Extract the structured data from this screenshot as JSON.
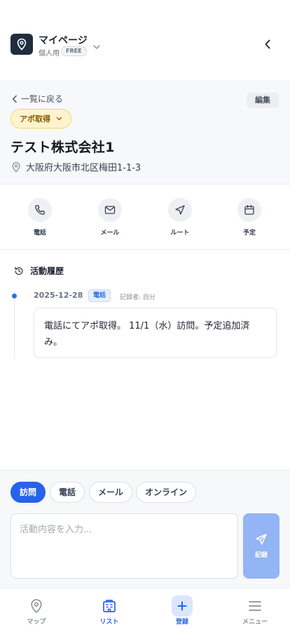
{
  "header": {
    "app_name": "マイページ",
    "plan_label": "個人用",
    "plan_badge": "FREE"
  },
  "detail": {
    "back_label": "一覧に戻る",
    "edit_label": "編集",
    "status": "アポ取得",
    "company_name": "テスト株式会社1",
    "address": "大阪府大阪市北区梅田1-1-3"
  },
  "actions": [
    {
      "label": "電話",
      "icon": "phone-icon"
    },
    {
      "label": "メール",
      "icon": "mail-icon"
    },
    {
      "label": "ルート",
      "icon": "navigation-icon"
    },
    {
      "label": "予定",
      "icon": "calendar-icon"
    }
  ],
  "history": {
    "title": "活動履歴",
    "entries": [
      {
        "date": "2025-12-28",
        "type": "電話",
        "author": "記録者: 自分",
        "body": "電話にてアポ取得。 11/1（水）訪問。予定追加済み。"
      }
    ]
  },
  "composer": {
    "chips": [
      "訪問",
      "電話",
      "メール",
      "オンライン"
    ],
    "active_chip": "訪問",
    "placeholder": "活動内容を入力...",
    "value": "",
    "record_label": "記録"
  },
  "tabbar": {
    "tabs": [
      {
        "label": "マップ",
        "icon": "map-pin-icon",
        "active": false
      },
      {
        "label": "リスト",
        "icon": "building-icon",
        "active": true
      },
      {
        "label": "登録",
        "icon": "plus-icon",
        "active": false
      },
      {
        "label": "メニュー",
        "icon": "menu-icon",
        "active": false
      }
    ]
  },
  "colors": {
    "primary": "#2563eb",
    "status_bg": "#fdf4cf",
    "status_text": "#8a5a00",
    "record_button": "#93b4f5"
  }
}
